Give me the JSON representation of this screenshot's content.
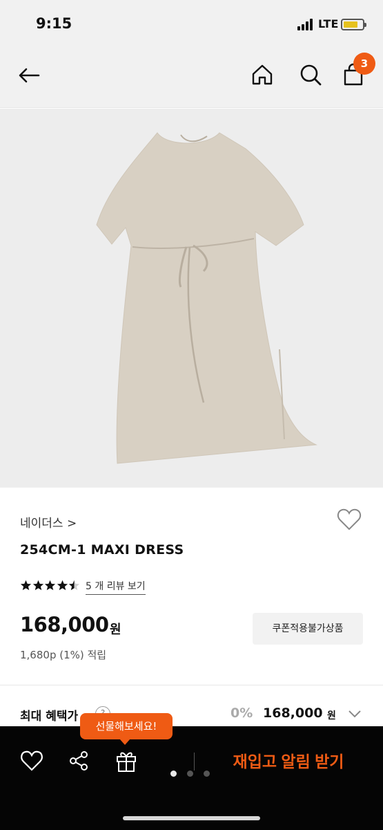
{
  "status_bar": {
    "time": "9:15",
    "network": "LTE",
    "battery_level": 0.75,
    "battery_color": "#e6c21e"
  },
  "app_bar": {
    "back_icon": "back-arrow-icon",
    "home_icon": "home-icon",
    "search_icon": "search-icon",
    "cart_icon": "shopping-bag-icon",
    "cart_count": "3",
    "accent_color": "#ef5b14"
  },
  "product": {
    "image_icon": "product-photo",
    "brand": "네이더스 >",
    "name": "254CM-1 MAXI DRESS",
    "rating": 4.5,
    "review_link": "5 개 리뷰 보기",
    "price": "168,000",
    "price_unit": "원",
    "coupon_label": "쿠폰적용불가상품",
    "points": "1,680p (1%) 적립"
  },
  "benefit": {
    "label": "최대 혜택가",
    "help": "?",
    "discount": "0%",
    "price": "168,000",
    "unit": "원"
  },
  "bottom_bar": {
    "tooltip": "선물해보세요!",
    "restock_label": "재입고 알림 받기",
    "page_dots": 3,
    "active_dot": 1
  }
}
